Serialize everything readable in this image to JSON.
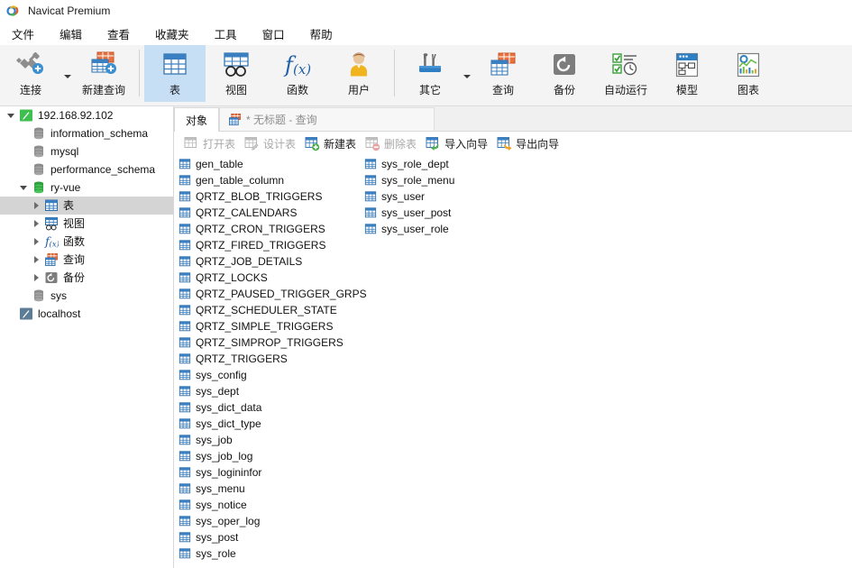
{
  "window": {
    "title": "Navicat Premium",
    "logo_icon": "navicat-logo-icon"
  },
  "menubar": {
    "items": [
      {
        "label": "文件",
        "name": "menu-file"
      },
      {
        "label": "编辑",
        "name": "menu-edit"
      },
      {
        "label": "查看",
        "name": "menu-view"
      },
      {
        "label": "收藏夹",
        "name": "menu-favorites"
      },
      {
        "label": "工具",
        "name": "menu-tools"
      },
      {
        "label": "窗口",
        "name": "menu-window"
      },
      {
        "label": "帮助",
        "name": "menu-help"
      }
    ]
  },
  "toolbar": {
    "buttons": [
      {
        "label": "连接",
        "icon": "connection-icon",
        "name": "toolbar-connection",
        "selected": false,
        "caret": true
      },
      {
        "label": "新建查询",
        "icon": "new-query-icon",
        "name": "toolbar-new-query",
        "selected": false,
        "caret": false
      },
      {
        "label": "表",
        "icon": "table-icon",
        "name": "toolbar-table",
        "selected": true,
        "caret": false
      },
      {
        "label": "视图",
        "icon": "view-icon",
        "name": "toolbar-view",
        "selected": false,
        "caret": false
      },
      {
        "label": "函数",
        "icon": "function-icon",
        "name": "toolbar-function",
        "selected": false,
        "caret": false
      },
      {
        "label": "用户",
        "icon": "user-icon",
        "name": "toolbar-user",
        "selected": false,
        "caret": false
      },
      {
        "label": "其它",
        "icon": "other-tools-icon",
        "name": "toolbar-other",
        "selected": false,
        "caret": true
      },
      {
        "label": "查询",
        "icon": "query-icon",
        "name": "toolbar-query",
        "selected": false,
        "caret": false
      },
      {
        "label": "备份",
        "icon": "backup-icon",
        "name": "toolbar-backup",
        "selected": false,
        "caret": false
      },
      {
        "label": "自动运行",
        "icon": "automation-icon",
        "name": "toolbar-automation",
        "selected": false,
        "caret": false
      },
      {
        "label": "模型",
        "icon": "model-icon",
        "name": "toolbar-model",
        "selected": false,
        "caret": false
      },
      {
        "label": "图表",
        "icon": "chart-icon",
        "name": "toolbar-chart",
        "selected": false,
        "caret": false
      }
    ]
  },
  "sidebar": {
    "nodes": [
      {
        "label": "192.168.92.102",
        "icon": "connection-active-icon",
        "indent": 0,
        "twisty": "down",
        "selected": false,
        "name": "tree-connection-192-168-92-102"
      },
      {
        "label": "information_schema",
        "icon": "database-icon",
        "indent": 1,
        "twisty": "none",
        "selected": false,
        "name": "tree-db-information-schema"
      },
      {
        "label": "mysql",
        "icon": "database-icon",
        "indent": 1,
        "twisty": "none",
        "selected": false,
        "name": "tree-db-mysql"
      },
      {
        "label": "performance_schema",
        "icon": "database-icon",
        "indent": 1,
        "twisty": "none",
        "selected": false,
        "name": "tree-db-performance-schema"
      },
      {
        "label": "ry-vue",
        "icon": "database-open-icon",
        "indent": 1,
        "twisty": "down",
        "selected": false,
        "name": "tree-db-ry-vue"
      },
      {
        "label": "表",
        "icon": "table-icon",
        "indent": 2,
        "twisty": "right",
        "selected": true,
        "name": "tree-node-tables"
      },
      {
        "label": "视图",
        "icon": "view-icon",
        "indent": 2,
        "twisty": "right",
        "selected": false,
        "name": "tree-node-views"
      },
      {
        "label": "函数",
        "icon": "function-icon",
        "indent": 2,
        "twisty": "right",
        "selected": false,
        "name": "tree-node-functions"
      },
      {
        "label": "查询",
        "icon": "query-icon",
        "indent": 2,
        "twisty": "right",
        "selected": false,
        "name": "tree-node-queries"
      },
      {
        "label": "备份",
        "icon": "backup-icon",
        "indent": 2,
        "twisty": "right",
        "selected": false,
        "name": "tree-node-backups"
      },
      {
        "label": "sys",
        "icon": "database-icon",
        "indent": 1,
        "twisty": "none",
        "selected": false,
        "name": "tree-db-sys"
      },
      {
        "label": "localhost",
        "icon": "connection-inactive-icon",
        "indent": 0,
        "twisty": "none",
        "selected": false,
        "name": "tree-connection-localhost"
      }
    ]
  },
  "tabs": [
    {
      "label": "对象",
      "active": true,
      "icon": null,
      "name": "tab-objects"
    },
    {
      "label": "* 无标题 - 查询",
      "active": false,
      "icon": "query-icon",
      "name": "tab-untitled-query"
    }
  ],
  "actionbar": {
    "buttons": [
      {
        "label": "打开表",
        "icon": "open-table-icon",
        "disabled": true,
        "name": "action-open-table"
      },
      {
        "label": "设计表",
        "icon": "design-table-icon",
        "disabled": true,
        "name": "action-design-table"
      },
      {
        "label": "新建表",
        "icon": "new-table-icon",
        "disabled": false,
        "name": "action-new-table"
      },
      {
        "label": "删除表",
        "icon": "delete-table-icon",
        "disabled": true,
        "name": "action-delete-table"
      },
      {
        "label": "导入向导",
        "icon": "import-wizard-icon",
        "disabled": false,
        "name": "action-import-wizard"
      },
      {
        "label": "导出向导",
        "icon": "export-wizard-icon",
        "disabled": false,
        "name": "action-export-wizard"
      }
    ]
  },
  "table_list": {
    "icon": "table-icon",
    "column1": [
      "gen_table",
      "gen_table_column",
      "QRTZ_BLOB_TRIGGERS",
      "QRTZ_CALENDARS",
      "QRTZ_CRON_TRIGGERS",
      "QRTZ_FIRED_TRIGGERS",
      "QRTZ_JOB_DETAILS",
      "QRTZ_LOCKS",
      "QRTZ_PAUSED_TRIGGER_GRPS",
      "QRTZ_SCHEDULER_STATE",
      "QRTZ_SIMPLE_TRIGGERS",
      "QRTZ_SIMPROP_TRIGGERS",
      "QRTZ_TRIGGERS",
      "sys_config",
      "sys_dept",
      "sys_dict_data",
      "sys_dict_type",
      "sys_job",
      "sys_job_log",
      "sys_logininfor",
      "sys_menu",
      "sys_notice",
      "sys_oper_log",
      "sys_post",
      "sys_role"
    ],
    "column2": [
      "sys_role_dept",
      "sys_role_menu",
      "sys_user",
      "sys_user_post",
      "sys_user_role"
    ]
  },
  "colors": {
    "accent_blue": "#3a7fc1",
    "toolbar_bg": "#f4f4f4",
    "selected_tool_bg": "#c7dff5",
    "tree_selected_bg": "#d4d4d4",
    "disabled_text": "#a8a8a8"
  }
}
